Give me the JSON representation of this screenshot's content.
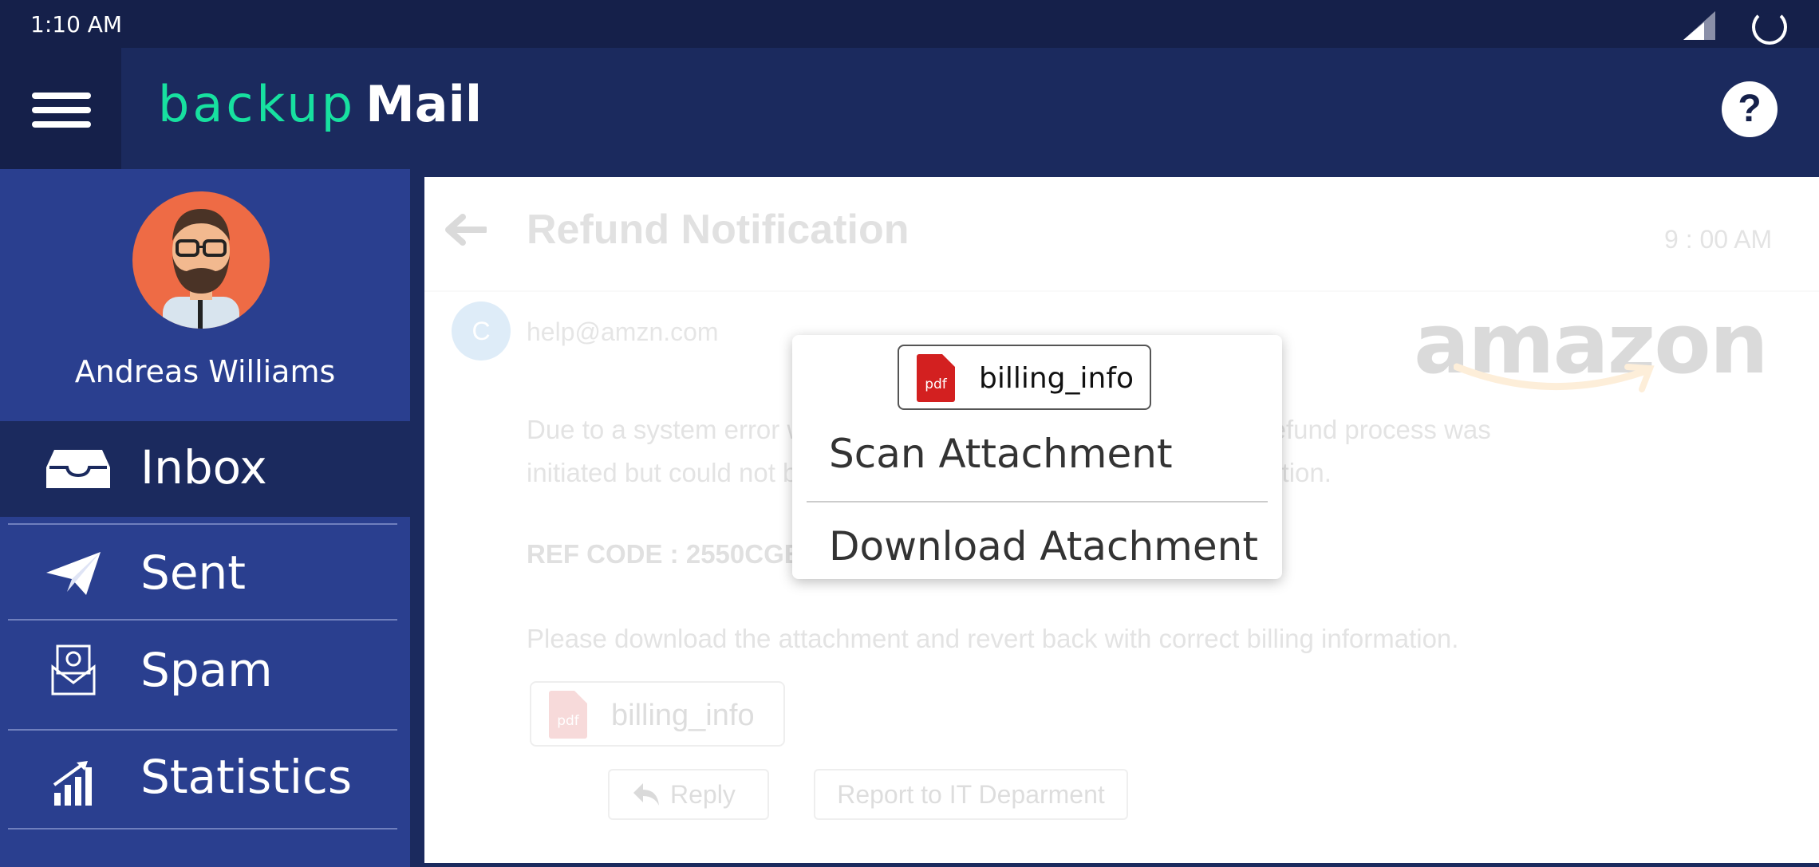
{
  "status_bar": {
    "time": "1:10 AM"
  },
  "header": {
    "logo_part1": "backup",
    "logo_part2": "Mail",
    "help_label": "?"
  },
  "sidebar": {
    "user_name": "Andreas Williams",
    "items": [
      {
        "label": "Inbox",
        "icon": "inbox-icon",
        "active": true
      },
      {
        "label": "Sent",
        "icon": "paper-plane-icon"
      },
      {
        "label": "Spam",
        "icon": "spam-envelope-icon"
      },
      {
        "label": "Statistics",
        "icon": "bar-chart-icon"
      }
    ]
  },
  "email": {
    "subject": "Refund Notification",
    "time": "9 : 00 AM",
    "sender_initial": "C",
    "sender": "help@amzn.com",
    "brand_logo": "amazon",
    "body_line1": "Due to a system error we were unable to process your order. A refund process was",
    "body_line2": "initiated but could not be completed due to error in billing information.",
    "ref_code": "REF CODE : 2550CGE",
    "body_line3": "Please download the attachment and revert back with correct billing information.",
    "attachment": {
      "name": "billing_info",
      "type_label": "pdf"
    },
    "reply_label": "Reply",
    "report_label": "Report to IT Deparment"
  },
  "popup": {
    "attachment_name": "billing_info",
    "type_label": "pdf",
    "option1": "Scan Attachment",
    "option2": "Download Atachment"
  },
  "colors": {
    "status_bar": "#15204a",
    "header": "#1b2a5e",
    "sidebar": "#2a3f8f",
    "logo_accent": "#17e0a0",
    "pdf_red": "#d32020"
  }
}
